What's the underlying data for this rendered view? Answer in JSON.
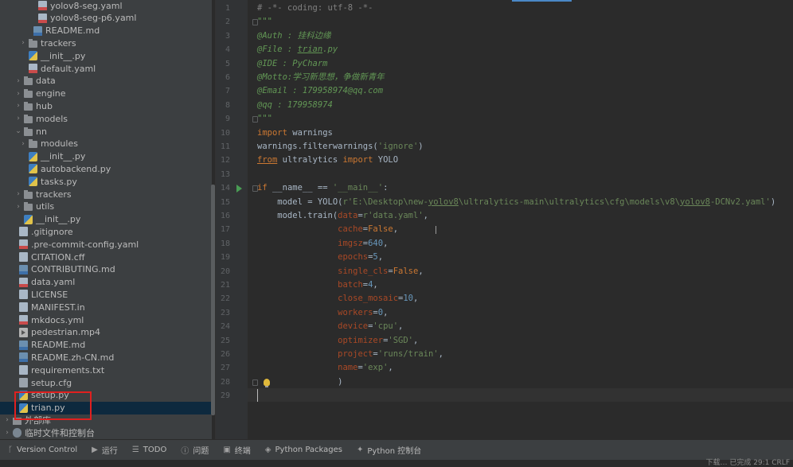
{
  "project_tree": {
    "items": [
      {
        "label": "yolov8-seg.yaml",
        "icon": "yaml-file-icon",
        "indent": 4,
        "arrow": ""
      },
      {
        "label": "yolov8-seg-p6.yaml",
        "icon": "yaml-file-icon",
        "indent": 4,
        "arrow": ""
      },
      {
        "label": "README.md",
        "icon": "markdown-file-icon",
        "indent": 3,
        "arrow": ""
      },
      {
        "label": "trackers",
        "icon": "folder-icon",
        "indent": 2,
        "arrow": "›"
      },
      {
        "label": "__init__.py",
        "icon": "python-file-icon",
        "indent": 2,
        "arrow": ""
      },
      {
        "label": "default.yaml",
        "icon": "yaml-file-icon",
        "indent": 2,
        "arrow": ""
      },
      {
        "label": "data",
        "icon": "folder-icon",
        "indent": 1,
        "arrow": "›"
      },
      {
        "label": "engine",
        "icon": "folder-icon",
        "indent": 1,
        "arrow": "›"
      },
      {
        "label": "hub",
        "icon": "folder-icon",
        "indent": 1,
        "arrow": "›"
      },
      {
        "label": "models",
        "icon": "folder-icon",
        "indent": 1,
        "arrow": "›"
      },
      {
        "label": "nn",
        "icon": "folder-icon",
        "indent": 1,
        "arrow": "⌄"
      },
      {
        "label": "modules",
        "icon": "folder-icon",
        "indent": 2,
        "arrow": "›"
      },
      {
        "label": "__init__.py",
        "icon": "python-file-icon",
        "indent": 2,
        "arrow": ""
      },
      {
        "label": "autobackend.py",
        "icon": "python-file-icon",
        "indent": 2,
        "arrow": ""
      },
      {
        "label": "tasks.py",
        "icon": "python-file-icon",
        "indent": 2,
        "arrow": ""
      },
      {
        "label": "trackers",
        "icon": "folder-icon",
        "indent": 1,
        "arrow": "›"
      },
      {
        "label": "utils",
        "icon": "folder-icon",
        "indent": 1,
        "arrow": "›"
      },
      {
        "label": "__init__.py",
        "icon": "python-file-icon",
        "indent": 1,
        "arrow": ""
      },
      {
        "label": ".gitignore",
        "icon": "text-file-icon",
        "indent": 0,
        "arrow": ""
      },
      {
        "label": ".pre-commit-config.yaml",
        "icon": "yaml-file-icon",
        "indent": 0,
        "arrow": ""
      },
      {
        "label": "CITATION.cff",
        "icon": "text-file-icon",
        "indent": 0,
        "arrow": ""
      },
      {
        "label": "CONTRIBUTING.md",
        "icon": "markdown-file-icon",
        "indent": 0,
        "arrow": ""
      },
      {
        "label": "data.yaml",
        "icon": "yaml-file-icon",
        "indent": 0,
        "arrow": ""
      },
      {
        "label": "LICENSE",
        "icon": "text-file-icon",
        "indent": 0,
        "arrow": ""
      },
      {
        "label": "MANIFEST.in",
        "icon": "text-file-icon",
        "indent": 0,
        "arrow": ""
      },
      {
        "label": "mkdocs.yml",
        "icon": "yaml-file-icon",
        "indent": 0,
        "arrow": ""
      },
      {
        "label": "pedestrian.mp4",
        "icon": "video-file-icon",
        "indent": 0,
        "arrow": ""
      },
      {
        "label": "README.md",
        "icon": "markdown-file-icon",
        "indent": 0,
        "arrow": ""
      },
      {
        "label": "README.zh-CN.md",
        "icon": "markdown-file-icon",
        "indent": 0,
        "arrow": ""
      },
      {
        "label": "requirements.txt",
        "icon": "text-file-icon",
        "indent": 0,
        "arrow": ""
      },
      {
        "label": "setup.cfg",
        "icon": "config-file-icon",
        "indent": 0,
        "arrow": ""
      },
      {
        "label": "setup.py",
        "icon": "python-file-icon",
        "indent": 0,
        "arrow": ""
      },
      {
        "label": "trian.py",
        "icon": "python-file-icon",
        "indent": 0,
        "arrow": "",
        "selected": true
      },
      {
        "label": "外部库",
        "icon": "library-icon",
        "indent": -1,
        "arrow": "›"
      },
      {
        "label": "临时文件和控制台",
        "icon": "scratches-icon",
        "indent": -1,
        "arrow": "›"
      }
    ]
  },
  "editor": {
    "line_numbers": [
      "1",
      "2",
      "3",
      "4",
      "5",
      "6",
      "7",
      "8",
      "9",
      "10",
      "11",
      "12",
      "13",
      "14",
      "15",
      "16",
      "17",
      "18",
      "19",
      "20",
      "21",
      "22",
      "23",
      "24",
      "25",
      "26",
      "27",
      "28",
      "29"
    ],
    "lines": [
      [
        {
          "t": "# -*- coding: utf-8 -*-",
          "c": "cm"
        }
      ],
      [
        {
          "t": "\"\"\"",
          "c": "doc"
        }
      ],
      [
        {
          "t": "@Auth : 挂科边缘",
          "c": "doc"
        }
      ],
      [
        {
          "t": "@File : ",
          "c": "doc"
        },
        {
          "t": "trian",
          "c": "doc ul"
        },
        {
          "t": ".py",
          "c": "doc"
        }
      ],
      [
        {
          "t": "@IDE : PyCharm",
          "c": "doc"
        }
      ],
      [
        {
          "t": "@Motto:学习新思想，争做新青年",
          "c": "doc"
        }
      ],
      [
        {
          "t": "@Email : 179958974@qq.com",
          "c": "doc"
        }
      ],
      [
        {
          "t": "@qq : 179958974",
          "c": "doc"
        }
      ],
      [
        {
          "t": "\"\"\"",
          "c": "doc"
        }
      ],
      [
        {
          "t": "import",
          "c": "kw"
        },
        {
          "t": " warnings",
          "c": ""
        }
      ],
      [
        {
          "t": "warnings.filterwarnings(",
          "c": ""
        },
        {
          "t": "'ignore'",
          "c": "str"
        },
        {
          "t": ")",
          "c": ""
        }
      ],
      [
        {
          "t": "from",
          "c": "kw ul"
        },
        {
          "t": " ultralytics ",
          "c": ""
        },
        {
          "t": "import",
          "c": "kw"
        },
        {
          "t": " YOLO",
          "c": ""
        }
      ],
      [],
      [
        {
          "t": "if",
          "c": "kw"
        },
        {
          "t": " __name__ == ",
          "c": ""
        },
        {
          "t": "'__main__'",
          "c": "str"
        },
        {
          "t": ":",
          "c": ""
        }
      ],
      [
        {
          "t": "    model = YOLO(",
          "c": ""
        },
        {
          "t": "r'E:\\Desktop\\new-",
          "c": "str"
        },
        {
          "t": "yolov8",
          "c": "str ul"
        },
        {
          "t": "\\ultralytics-main\\ultralytics\\cfg\\models\\v8\\",
          "c": "str"
        },
        {
          "t": "yolov8",
          "c": "str ul"
        },
        {
          "t": "-DCNv2.yaml'",
          "c": "str"
        },
        {
          "t": ")",
          "c": ""
        }
      ],
      [
        {
          "t": "    model.train(",
          "c": ""
        },
        {
          "t": "data",
          "c": "param"
        },
        {
          "t": "=",
          "c": ""
        },
        {
          "t": "r'data.yaml'",
          "c": "str"
        },
        {
          "t": ",",
          "c": ""
        }
      ],
      [
        {
          "t": "                ",
          "c": ""
        },
        {
          "t": "cache",
          "c": "param"
        },
        {
          "t": "=",
          "c": ""
        },
        {
          "t": "False",
          "c": "kw"
        },
        {
          "t": ",",
          "c": ""
        }
      ],
      [
        {
          "t": "                ",
          "c": ""
        },
        {
          "t": "imgsz",
          "c": "param"
        },
        {
          "t": "=",
          "c": ""
        },
        {
          "t": "640",
          "c": "num"
        },
        {
          "t": ",",
          "c": ""
        }
      ],
      [
        {
          "t": "                ",
          "c": ""
        },
        {
          "t": "epochs",
          "c": "param"
        },
        {
          "t": "=",
          "c": ""
        },
        {
          "t": "5",
          "c": "num"
        },
        {
          "t": ",",
          "c": ""
        }
      ],
      [
        {
          "t": "                ",
          "c": ""
        },
        {
          "t": "single_cls",
          "c": "param"
        },
        {
          "t": "=",
          "c": ""
        },
        {
          "t": "False",
          "c": "kw"
        },
        {
          "t": ",",
          "c": ""
        }
      ],
      [
        {
          "t": "                ",
          "c": ""
        },
        {
          "t": "batch",
          "c": "param"
        },
        {
          "t": "=",
          "c": ""
        },
        {
          "t": "4",
          "c": "num"
        },
        {
          "t": ",",
          "c": ""
        }
      ],
      [
        {
          "t": "                ",
          "c": ""
        },
        {
          "t": "close_mosaic",
          "c": "param"
        },
        {
          "t": "=",
          "c": ""
        },
        {
          "t": "10",
          "c": "num"
        },
        {
          "t": ",",
          "c": ""
        }
      ],
      [
        {
          "t": "                ",
          "c": ""
        },
        {
          "t": "workers",
          "c": "param"
        },
        {
          "t": "=",
          "c": ""
        },
        {
          "t": "0",
          "c": "num"
        },
        {
          "t": ",",
          "c": ""
        }
      ],
      [
        {
          "t": "                ",
          "c": ""
        },
        {
          "t": "device",
          "c": "param"
        },
        {
          "t": "=",
          "c": ""
        },
        {
          "t": "'cpu'",
          "c": "str"
        },
        {
          "t": ",",
          "c": ""
        }
      ],
      [
        {
          "t": "                ",
          "c": ""
        },
        {
          "t": "optimizer",
          "c": "param"
        },
        {
          "t": "=",
          "c": ""
        },
        {
          "t": "'SGD'",
          "c": "str"
        },
        {
          "t": ",",
          "c": ""
        }
      ],
      [
        {
          "t": "                ",
          "c": ""
        },
        {
          "t": "project",
          "c": "param"
        },
        {
          "t": "=",
          "c": ""
        },
        {
          "t": "'runs/train'",
          "c": "str"
        },
        {
          "t": ",",
          "c": ""
        }
      ],
      [
        {
          "t": "                ",
          "c": ""
        },
        {
          "t": "name",
          "c": "param"
        },
        {
          "t": "=",
          "c": ""
        },
        {
          "t": "'exp'",
          "c": "str"
        },
        {
          "t": ",",
          "c": ""
        }
      ],
      [
        {
          "t": "                )",
          "c": ""
        }
      ],
      []
    ]
  },
  "toolbar": {
    "items": [
      {
        "label": "Version Control",
        "icon": "branch-icon",
        "glyph": "ᚴ"
      },
      {
        "label": "运行",
        "icon": "run-icon",
        "glyph": "▶"
      },
      {
        "label": "TODO",
        "icon": "list-icon",
        "glyph": "☰"
      },
      {
        "label": "问题",
        "icon": "problems-icon",
        "glyph": "ⓘ"
      },
      {
        "label": "终端",
        "icon": "terminal-icon",
        "glyph": "▣"
      },
      {
        "label": "Python Packages",
        "icon": "packages-icon",
        "glyph": "◈"
      },
      {
        "label": "Python 控制台",
        "icon": "python-console-icon",
        "glyph": "✦"
      }
    ]
  },
  "status": {
    "right_text": "下载… 已完成  29:1  CRLF"
  },
  "colors": {
    "highlight_box": "#e0201f",
    "selection": "#0d293e"
  }
}
